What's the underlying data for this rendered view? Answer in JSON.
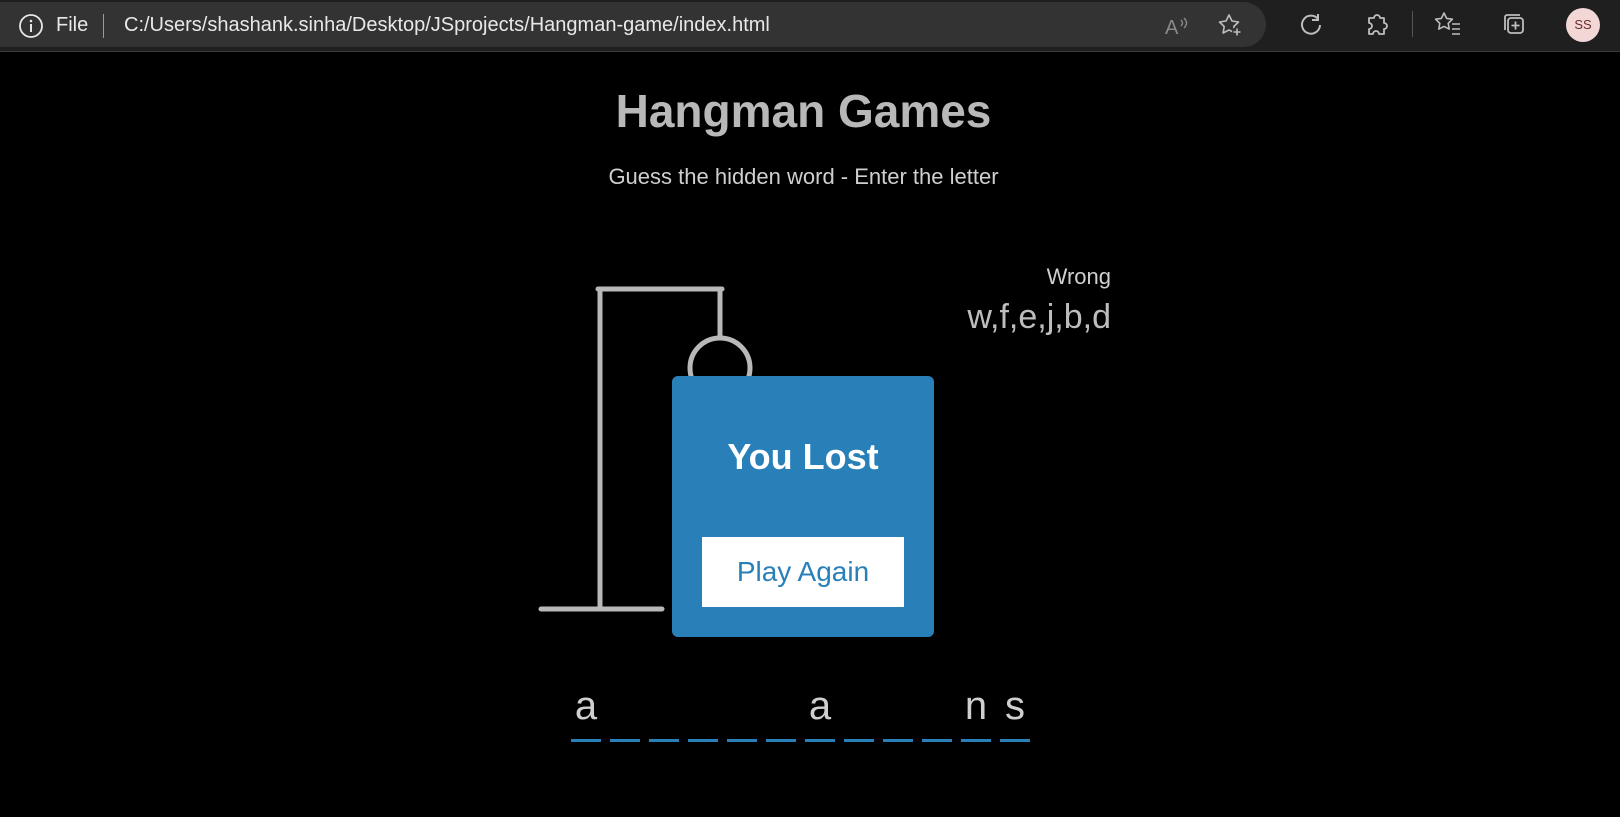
{
  "browser": {
    "file_label": "File",
    "url": "C:/Users/shashank.sinha/Desktop/JSprojects/Hangman-game/index.html",
    "profile_initials": "SS"
  },
  "page": {
    "title": "Hangman Games",
    "subtitle": "Guess the hidden word - Enter the letter"
  },
  "wrong": {
    "label": "Wrong",
    "letters": "w,f,e,j,b,d"
  },
  "popup": {
    "message": "You Lost",
    "button_label": "Play Again"
  },
  "word": {
    "letters": [
      "a",
      "",
      "",
      "",
      "",
      "",
      "a",
      "",
      "",
      "",
      "n",
      "s"
    ]
  },
  "colors": {
    "accent": "#2980b9",
    "figure": "#b8b8b8",
    "background": "#000000"
  }
}
